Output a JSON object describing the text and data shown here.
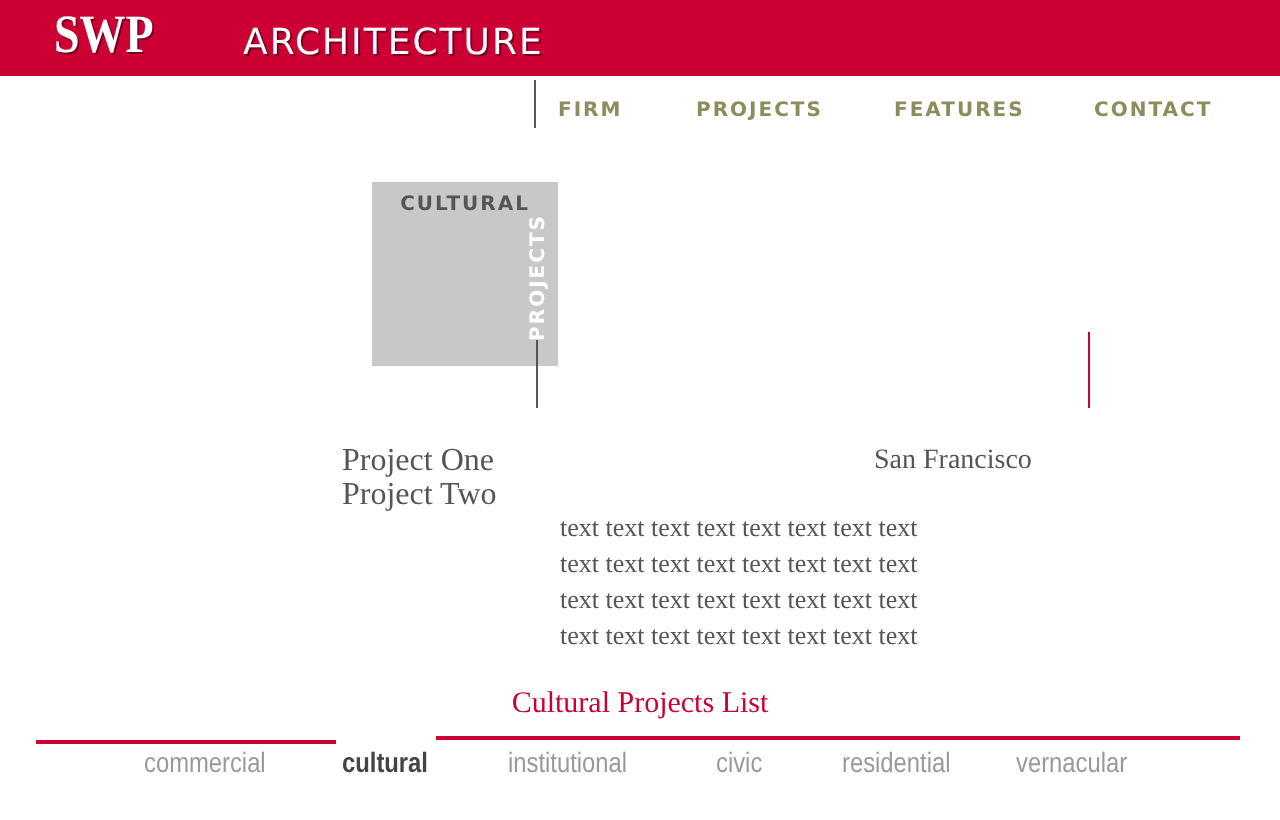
{
  "header": {
    "logo": "SWP",
    "title": "ARCHITECTURE"
  },
  "nav": [
    "FIRM",
    "PROJECTS",
    "FEATURES",
    "CONTACT"
  ],
  "section_box": {
    "title": "CULTURAL",
    "subtitle": "PROJECTS"
  },
  "projects": [
    "Project One",
    "Project Two"
  ],
  "location": "San Francisco",
  "body_lines": [
    "text text text text text text text text",
    "text text text text text text text text",
    "text text text text text text text text",
    "text text text text text text text text"
  ],
  "list_title": "Cultural Projects List",
  "categories": [
    {
      "label": "commercial",
      "selected": false
    },
    {
      "label": "cultural",
      "selected": true
    },
    {
      "label": "institutional",
      "selected": false
    },
    {
      "label": "civic",
      "selected": false
    },
    {
      "label": "residential",
      "selected": false
    },
    {
      "label": "vernacular",
      "selected": false
    }
  ]
}
